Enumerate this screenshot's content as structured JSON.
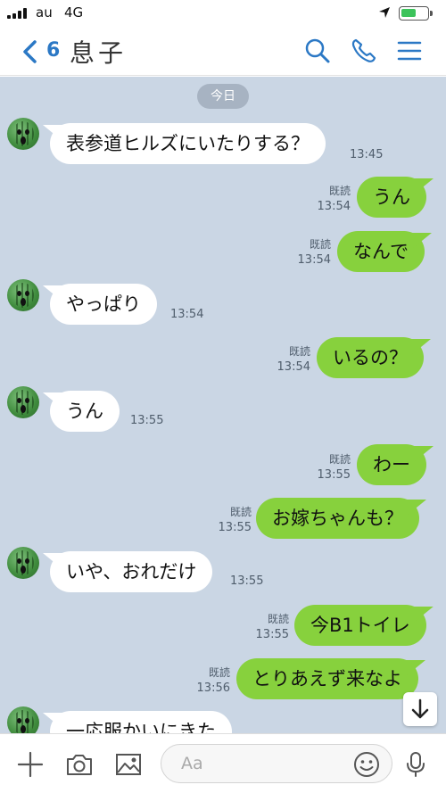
{
  "status_bar": {
    "carrier": "au",
    "network": "4G",
    "battery_level": 0.55,
    "icons": [
      "signal-icon",
      "location-arrow-icon",
      "battery-icon"
    ]
  },
  "header": {
    "back_count": "6",
    "chat_name": "息子",
    "icons": [
      "chevron-left-icon",
      "search-icon",
      "phone-icon",
      "menu-icon"
    ],
    "accent_color": "#2b78c5"
  },
  "chat": {
    "background_color": "#cad6e4",
    "date_label": "今日",
    "read_label": "既読",
    "messages": [
      {
        "dir": "in",
        "text": "表参道ヒルズにいたりする？",
        "time": "13:45"
      },
      {
        "dir": "out",
        "text": "うん",
        "time": "13:54"
      },
      {
        "dir": "out",
        "text": "なんで",
        "time": "13:54"
      },
      {
        "dir": "in",
        "text": "やっぱり",
        "time": "13:54"
      },
      {
        "dir": "out",
        "text": "いるの？",
        "time": "13:54"
      },
      {
        "dir": "in",
        "text": "うん",
        "time": "13:55"
      },
      {
        "dir": "out",
        "text": "わー",
        "time": "13:55"
      },
      {
        "dir": "out",
        "text": "お嫁ちゃんも？",
        "time": "13:55"
      },
      {
        "dir": "in",
        "text": "いや、おれだけ",
        "time": "13:55"
      },
      {
        "dir": "out",
        "text": "今B1トイレ",
        "time": "13:55"
      },
      {
        "dir": "out",
        "text": "とりあえず来なよ",
        "time": "13:56"
      },
      {
        "dir": "in",
        "text": "一応服かいにきた",
        "time": ""
      }
    ],
    "outgoing_color": "#87d13d",
    "incoming_color": "#ffffff"
  },
  "input_bar": {
    "placeholder": "Aa",
    "icons": [
      "plus-icon",
      "camera-icon",
      "image-icon",
      "emoji-icon",
      "microphone-icon"
    ]
  }
}
